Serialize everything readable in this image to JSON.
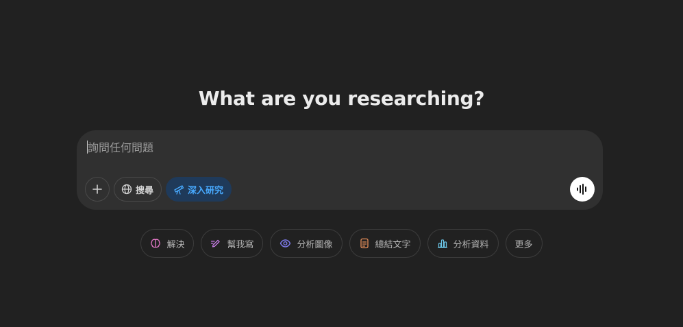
{
  "heading": "What are you researching?",
  "composer": {
    "placeholder": "詢問任何問題",
    "tools": {
      "search_label": "搜尋",
      "deep_research_label": "深入研究"
    }
  },
  "suggestions": [
    {
      "label": "解決",
      "icon": "brain-icon",
      "color": "#e87acb"
    },
    {
      "label": "幫我寫",
      "icon": "pen-icon",
      "color": "#c77ee6"
    },
    {
      "label": "分析圖像",
      "icon": "eye-icon",
      "color": "#7f7cf0"
    },
    {
      "label": "總結文字",
      "icon": "document-icon",
      "color": "#e9905a"
    },
    {
      "label": "分析資料",
      "icon": "bar-chart-icon",
      "color": "#6bc6e8"
    },
    {
      "label": "更多",
      "icon": "",
      "color": ""
    }
  ],
  "colors": {
    "background": "#212121",
    "composer": "#303030",
    "accent_blue": "#48aaff",
    "accent_blue_bg": "#1f3a5a"
  }
}
